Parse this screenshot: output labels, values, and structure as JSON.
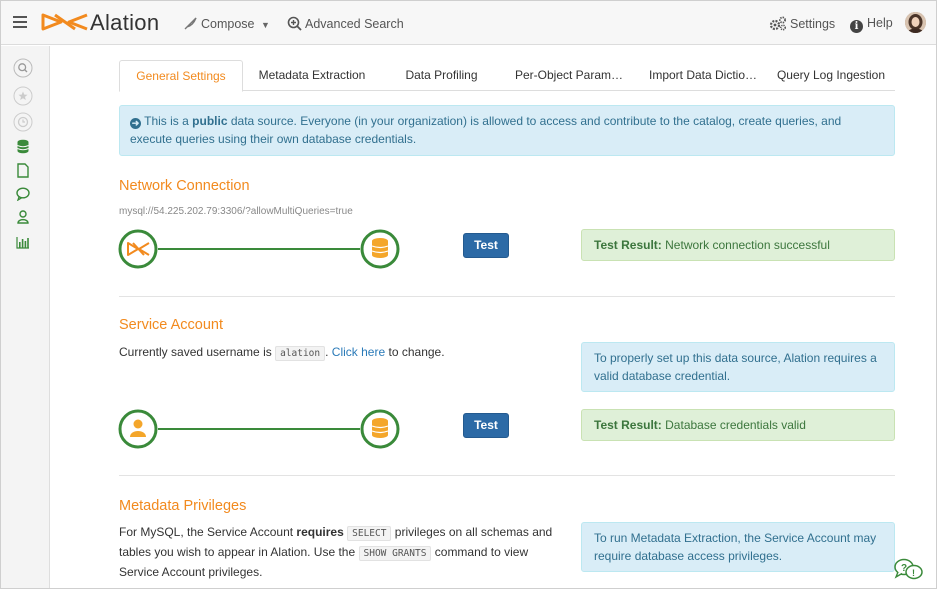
{
  "app": {
    "brand": "Alation",
    "nav": {
      "compose_label": "Compose",
      "advanced_search_label": "Advanced Search",
      "settings_label": "Settings",
      "help_label": "Help"
    },
    "colors": {
      "accent": "#f28a1e",
      "green": "#3a8a3a",
      "button_blue": "#2c6aa6"
    }
  },
  "sidebar": {
    "icons": [
      "search-icon",
      "star-icon",
      "clock-icon",
      "database-icon",
      "document-icon",
      "chat-icon",
      "user-icon",
      "chart-icon"
    ]
  },
  "tabs": [
    {
      "label": "General Settings",
      "active": true
    },
    {
      "label": "Metadata Extraction",
      "active": false
    },
    {
      "label": "Data Profiling",
      "active": false
    },
    {
      "label": "Per-Object Param…",
      "active": false
    },
    {
      "label": "Import Data Dictio…",
      "active": false
    },
    {
      "label": "Query Log Ingestion",
      "active": false
    }
  ],
  "public_notice": {
    "prefix": "This is a",
    "bold": "public",
    "suffix": "data source. Everyone (in your organization) is allowed to access and contribute to the catalog, create queries, and execute queries using their own database credentials."
  },
  "network": {
    "title": "Network Connection",
    "uri": "mysql://54.225.202.79:3306/?allowMultiQueries=true",
    "test_label": "Test",
    "result_label": "Test Result:",
    "result_text": "Network connection successful"
  },
  "service": {
    "title": "Service Account",
    "text_before": "Currently saved username is",
    "username": "alation",
    "link": "Click here",
    "text_after": "to change.",
    "info": "To properly set up this data source, Alation requires a valid database credential.",
    "test_label": "Test",
    "result_label": "Test Result:",
    "result_text": "Database credentials valid"
  },
  "privileges": {
    "title": "Metadata Privileges",
    "t1": "For MySQL, the Service Account",
    "bold1": "requires",
    "code1": "SELECT",
    "t2": "privileges on all schemas and tables you wish to appear in Alation. Use the",
    "code2": "SHOW GRANTS",
    "t3": "command to view Service Account privileges.",
    "info": "To run Metadata Extraction, the Service Account may require database access privileges."
  }
}
